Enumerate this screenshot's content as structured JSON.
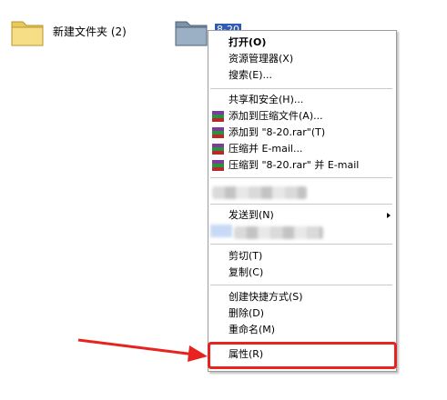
{
  "desktop": {
    "folders": [
      {
        "label": "新建文件夹 (2)",
        "icon": "folder-icon"
      },
      {
        "label": "8-20",
        "icon": "folder-icon",
        "selected": true
      }
    ]
  },
  "context_menu": {
    "items": [
      {
        "label": "打开(O)",
        "bold": true
      },
      {
        "label": "资源管理器(X)"
      },
      {
        "label": "搜索(E)..."
      },
      {
        "label": "共享和安全(H)..."
      },
      {
        "label": "添加到压缩文件(A)...",
        "icon": "winrar-icon"
      },
      {
        "label": "添加到 \"8-20.rar\"(T)",
        "icon": "winrar-icon"
      },
      {
        "label": "压缩并 E-mail...",
        "icon": "winrar-icon"
      },
      {
        "label": "压缩到 \"8-20.rar\" 并 E-mail",
        "icon": "winrar-icon"
      },
      {
        "label": "发送到(N)",
        "submenu": true
      },
      {
        "label": "剪切(T)"
      },
      {
        "label": "复制(C)"
      },
      {
        "label": "创建快捷方式(S)"
      },
      {
        "label": "删除(D)"
      },
      {
        "label": "重命名(M)"
      },
      {
        "label": "属性(R)",
        "highlighted": true
      }
    ]
  },
  "colors": {
    "highlight": "#e8231f",
    "selection": "#2f5bb7",
    "arrow": "#e8231f"
  }
}
